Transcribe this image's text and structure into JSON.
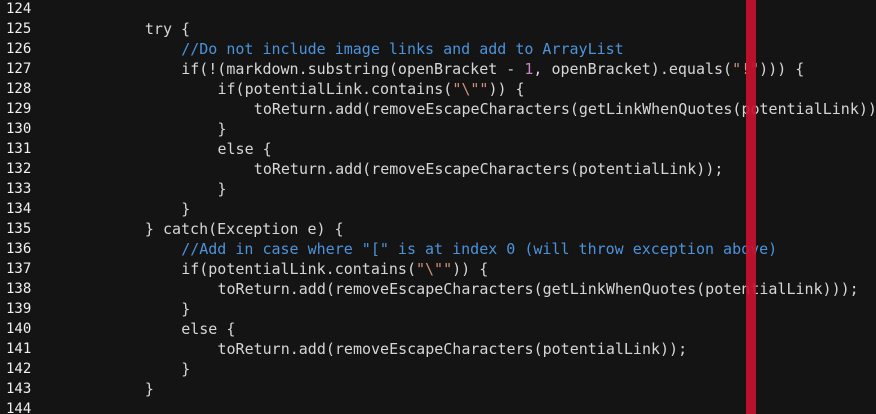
{
  "editor": {
    "theme": {
      "background": "#141414",
      "line_number_color": "#f0f0f0",
      "plain_text_color": "#d6d6d6",
      "comment_color": "#4b93dc",
      "string_color": "#ce9178",
      "number_color": "#c586c0",
      "ruler_color": "#c8102e"
    },
    "lines": [
      {
        "number": "124",
        "indent": 0,
        "tokens": []
      },
      {
        "number": "125",
        "indent": 3,
        "tokens": [
          {
            "type": "keyword",
            "text": "try {"
          }
        ]
      },
      {
        "number": "126",
        "indent": 4,
        "tokens": [
          {
            "type": "comment",
            "text": "//Do not include image links and add to ArrayList"
          }
        ]
      },
      {
        "number": "127",
        "indent": 4,
        "tokens": [
          {
            "type": "plain",
            "text": "if(!(markdown.substring(openBracket - "
          },
          {
            "type": "number",
            "text": "1"
          },
          {
            "type": "plain",
            "text": ", openBracket).equals("
          },
          {
            "type": "string",
            "text": "\"!\""
          },
          {
            "type": "plain",
            "text": "))) {"
          }
        ]
      },
      {
        "number": "128",
        "indent": 5,
        "tokens": [
          {
            "type": "plain",
            "text": "if(potentialLink.contains("
          },
          {
            "type": "string",
            "text": "\"\\\"\""
          },
          {
            "type": "plain",
            "text": ")) {"
          }
        ]
      },
      {
        "number": "129",
        "indent": 6,
        "tokens": [
          {
            "type": "plain",
            "text": "toReturn.add(removeEscapeCharacters(getLinkWhenQuotes(potentialLink)));"
          }
        ]
      },
      {
        "number": "130",
        "indent": 5,
        "tokens": [
          {
            "type": "plain",
            "text": "}"
          }
        ]
      },
      {
        "number": "131",
        "indent": 5,
        "tokens": [
          {
            "type": "plain",
            "text": "else {"
          }
        ]
      },
      {
        "number": "132",
        "indent": 6,
        "tokens": [
          {
            "type": "plain",
            "text": "toReturn.add(removeEscapeCharacters(potentialLink));"
          }
        ]
      },
      {
        "number": "133",
        "indent": 5,
        "tokens": [
          {
            "type": "plain",
            "text": "}"
          }
        ]
      },
      {
        "number": "134",
        "indent": 4,
        "tokens": [
          {
            "type": "plain",
            "text": "}"
          }
        ]
      },
      {
        "number": "135",
        "indent": 3,
        "tokens": [
          {
            "type": "plain",
            "text": "} catch(Exception e) {"
          }
        ]
      },
      {
        "number": "136",
        "indent": 4,
        "tokens": [
          {
            "type": "comment",
            "text": "//Add in case where \"[\" is at index 0 (will throw exception above)"
          }
        ]
      },
      {
        "number": "137",
        "indent": 4,
        "tokens": [
          {
            "type": "plain",
            "text": "if(potentialLink.contains("
          },
          {
            "type": "string",
            "text": "\"\\\"\""
          },
          {
            "type": "plain",
            "text": ")) {"
          }
        ]
      },
      {
        "number": "138",
        "indent": 5,
        "tokens": [
          {
            "type": "plain",
            "text": "toReturn.add(removeEscapeCharacters(getLinkWhenQuotes(potentialLink)));"
          }
        ]
      },
      {
        "number": "139",
        "indent": 4,
        "tokens": [
          {
            "type": "plain",
            "text": "}"
          }
        ]
      },
      {
        "number": "140",
        "indent": 4,
        "tokens": [
          {
            "type": "plain",
            "text": "else {"
          }
        ]
      },
      {
        "number": "141",
        "indent": 5,
        "tokens": [
          {
            "type": "plain",
            "text": "toReturn.add(removeEscapeCharacters(potentialLink));"
          }
        ]
      },
      {
        "number": "142",
        "indent": 4,
        "tokens": [
          {
            "type": "plain",
            "text": "}"
          }
        ]
      },
      {
        "number": "143",
        "indent": 3,
        "tokens": [
          {
            "type": "plain",
            "text": "}"
          }
        ]
      },
      {
        "number": "144",
        "indent": 0,
        "tokens": []
      }
    ]
  }
}
